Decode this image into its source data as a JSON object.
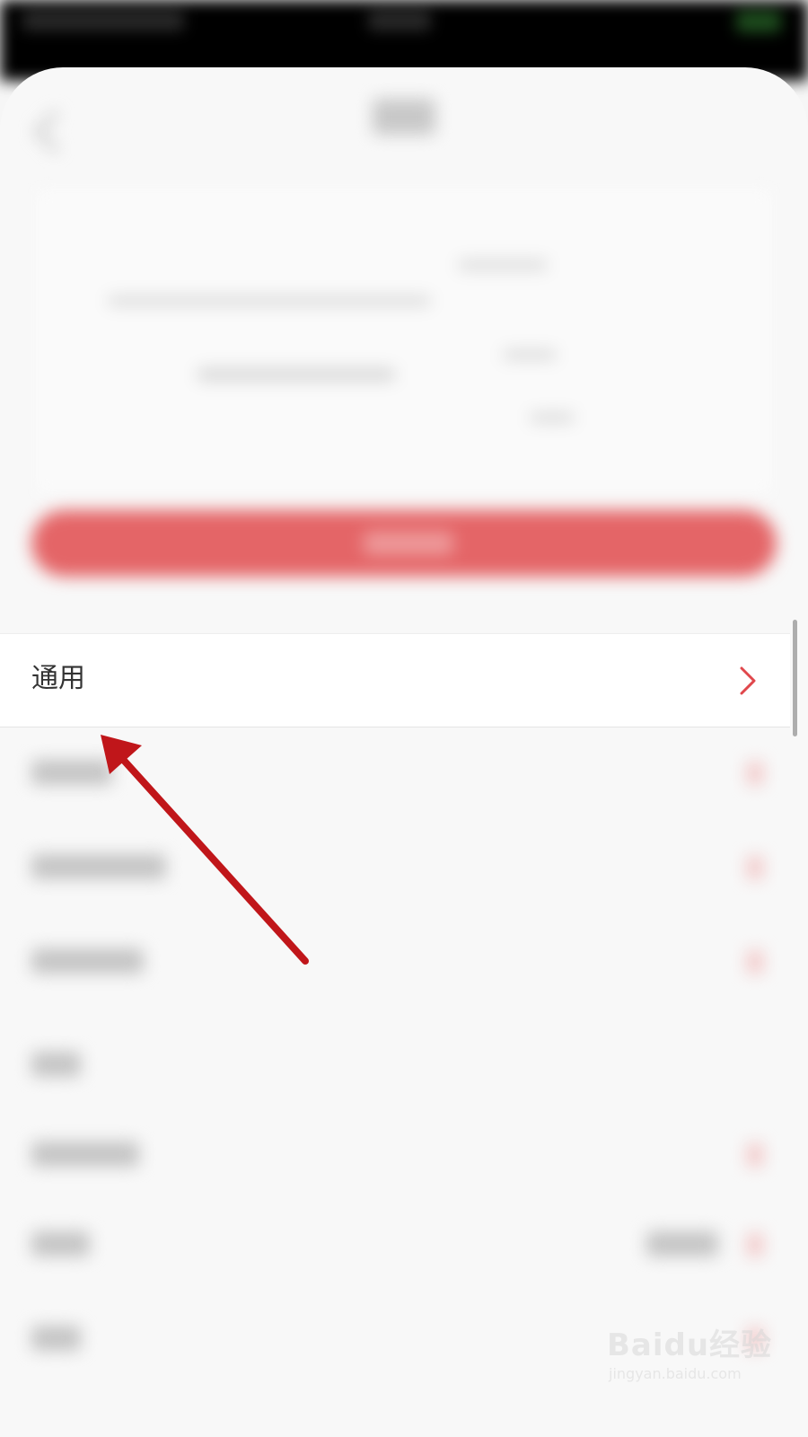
{
  "settings_list": {
    "general_row": {
      "label": "通用",
      "chevron_color": "#e0474c"
    }
  },
  "annotation": {
    "arrow_color": "#c0161a"
  },
  "watermark": {
    "brand": "Baidu经验",
    "url": "jingyan.baidu.com"
  },
  "colors": {
    "primary_button": "#e46567",
    "background": "#f8f8f8",
    "row_background": "#ffffff"
  }
}
